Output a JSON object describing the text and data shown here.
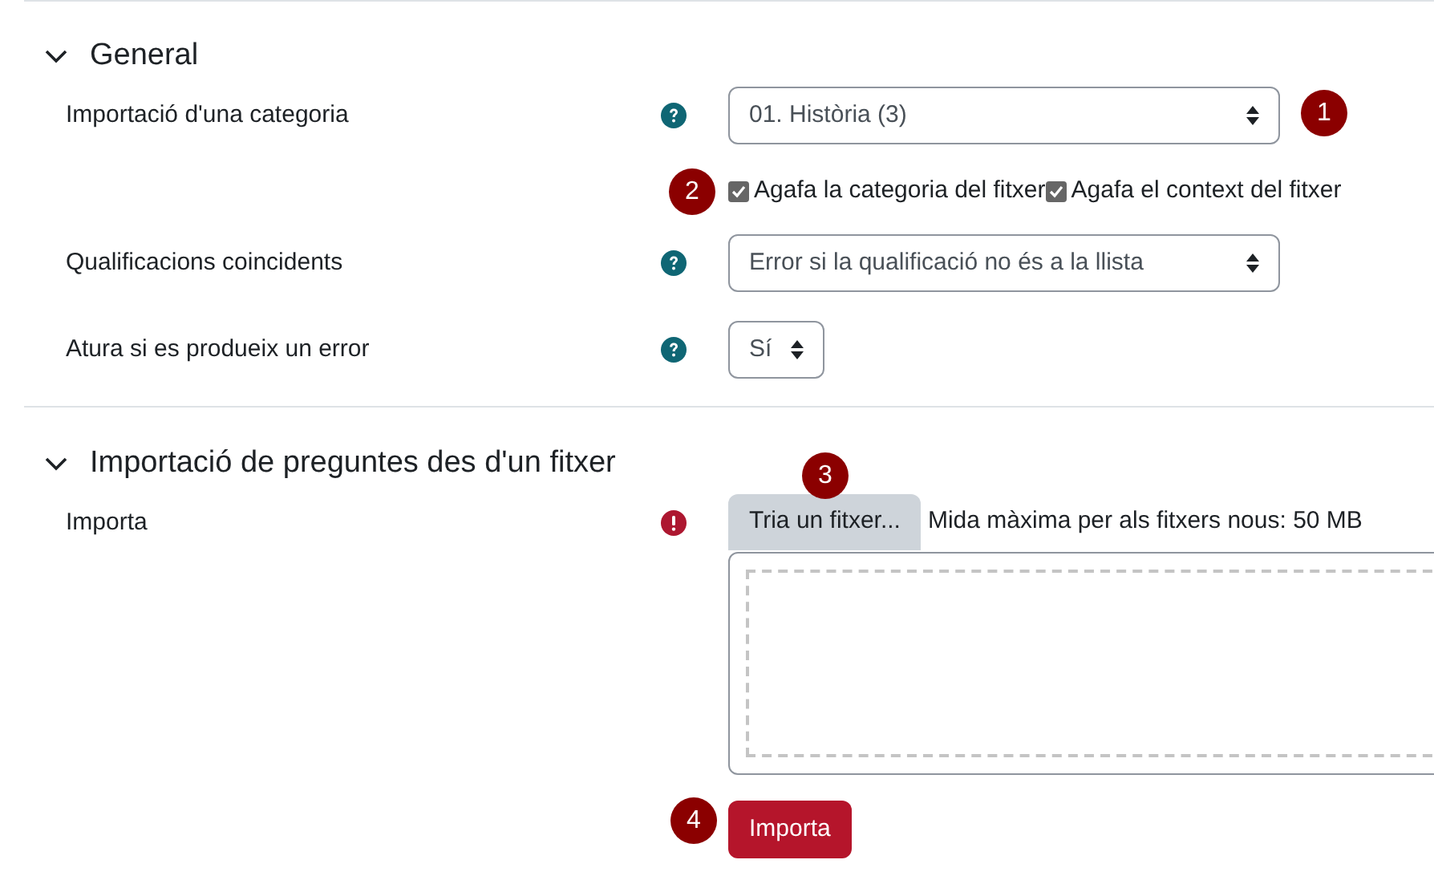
{
  "sections": [
    {
      "title": "General",
      "expanded": true,
      "rows": [
        {
          "kind": "select",
          "label": "Importació d'una categoria",
          "required": false,
          "value": "01. Història (3)"
        },
        {
          "kind": "checkboxes",
          "options": [
            {
              "label": "Agafa la categoria del fitxer",
              "checked": true
            },
            {
              "label": "Agafa el context del fitxer",
              "checked": true
            }
          ]
        },
        {
          "kind": "select",
          "label": "Qualificacions coincidents",
          "required": false,
          "value": "Error si la qualificació no és a la llista"
        },
        {
          "kind": "short-select",
          "label": "Atura si es produeix un error",
          "required": false,
          "value": "Sí"
        }
      ]
    },
    {
      "title": "Importació de preguntes des d'un fitxer",
      "expanded": true,
      "rows": [
        {
          "kind": "filepicker",
          "label": "Importa",
          "required": true,
          "button": "Tria un fitxer...",
          "note": "Mida màxima per als fitxers nous: 50 MB"
        }
      ]
    }
  ],
  "submit": "Importa",
  "markers": [
    "1",
    "2",
    "3",
    "4"
  ]
}
